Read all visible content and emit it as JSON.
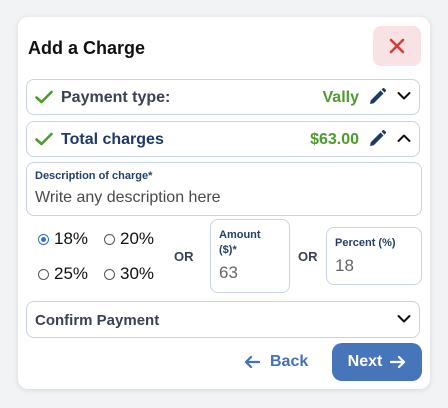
{
  "header": {
    "title": "Add a Charge"
  },
  "payment_type": {
    "label": "Payment type:",
    "value": "Vally"
  },
  "total_charges": {
    "label": "Total charges",
    "value": "$63.00"
  },
  "description": {
    "label": "Description of charge*",
    "placeholder": "Write any description here",
    "value": ""
  },
  "percent_options": [
    {
      "label": "18%",
      "selected": true
    },
    {
      "label": "20%",
      "selected": false
    },
    {
      "label": "25%",
      "selected": false
    },
    {
      "label": "30%",
      "selected": false
    }
  ],
  "or_text": "OR",
  "amount": {
    "label_line1": "Amount",
    "label_line2": "($)*",
    "value": "63"
  },
  "percent": {
    "label": "Percent (%)",
    "value": "18"
  },
  "confirm_payment": {
    "label": "Confirm Payment"
  },
  "footer": {
    "back_label": "Back",
    "next_label": "Next"
  },
  "colors": {
    "accent_green": "#4e9a2e",
    "primary_blue": "#4775b9",
    "close_bg": "#f8e2e4",
    "close_icon": "#d63a3a"
  }
}
